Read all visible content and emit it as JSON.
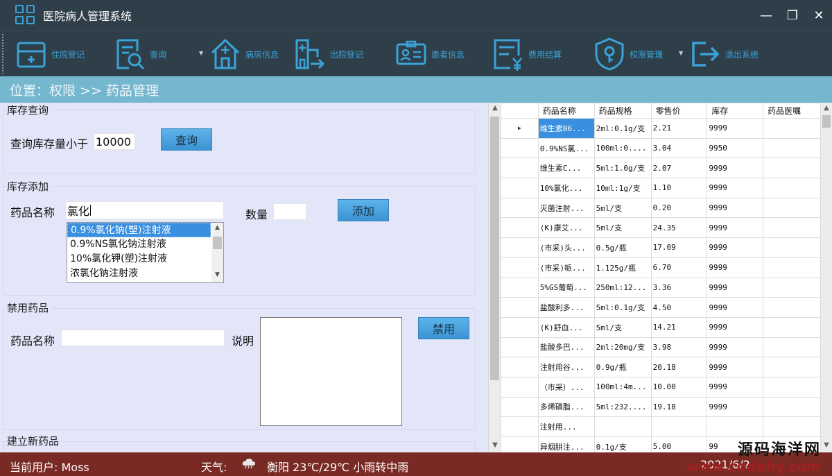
{
  "window": {
    "title": "医院病人管理系统",
    "controls": [
      "—",
      "❐",
      "✕"
    ]
  },
  "toolbar": {
    "items": [
      {
        "label": "住院登记",
        "icon": "admission-icon"
      },
      {
        "label": "查询",
        "icon": "search-document-icon"
      },
      {
        "label": "病房信息",
        "icon": "ward-icon"
      },
      {
        "label": "出院登记",
        "icon": "discharge-icon"
      },
      {
        "label": "患者信息",
        "icon": "patient-card-icon"
      },
      {
        "label": "费用结算",
        "icon": "billing-icon"
      },
      {
        "label": "权限管理",
        "icon": "permission-shield-icon"
      },
      {
        "label": "退出系统",
        "icon": "exit-icon"
      }
    ]
  },
  "breadcrumb": {
    "text": "位置：权限 >> 药品管理"
  },
  "stock_query": {
    "title": "库存查询",
    "label": "查询库存量小于",
    "value": "10000",
    "button": "查询"
  },
  "stock_add": {
    "title": "库存添加",
    "name_label": "药品名称",
    "name_value": "氯化",
    "qty_label": "数量",
    "qty_value": "",
    "button": "添加",
    "suggestions": [
      "0.9%氯化钠(塑)注射液",
      "0.9%NS氯化钠注射液",
      "10%氯化钾(塑)注射液",
      "浓氯化钠注射液"
    ],
    "selected_index": 0
  },
  "ban_drug": {
    "title": "禁用药品",
    "name_label": "药品名称",
    "name_value": "",
    "note_label": "说明",
    "button": "禁用"
  },
  "new_drug": {
    "title": "建立新药品"
  },
  "grid": {
    "columns": [
      "药品名称",
      "药品规格",
      "零售价",
      "库存",
      "药品医嘱"
    ],
    "rows": [
      [
        "维生素B6...",
        "2ml:0.1g/支",
        "2.21",
        "9999",
        ""
      ],
      [
        "0.9%NS氯...",
        "100ml:0....",
        "3.04",
        "9950",
        ""
      ],
      [
        "维生素C...",
        "5ml:1.0g/支",
        "2.07",
        "9999",
        ""
      ],
      [
        "10%氯化...",
        "10ml:1g/支",
        "1.10",
        "9999",
        ""
      ],
      [
        "灭菌注射...",
        "5ml/支",
        "0.20",
        "9999",
        ""
      ],
      [
        "(K)康艾...",
        "5ml/支",
        "24.35",
        "9999",
        ""
      ],
      [
        "(市采)头...",
        "0.5g/瓶",
        "17.09",
        "9999",
        ""
      ],
      [
        "(市采)哌...",
        "1.125g/瓶",
        "6.70",
        "9999",
        ""
      ],
      [
        "5%GS葡萄...",
        "250ml:12...",
        "3.36",
        "9999",
        ""
      ],
      [
        "盐酸利多...",
        "5ml:0.1g/支",
        "4.50",
        "9999",
        ""
      ],
      [
        "(K)舒血...",
        "5ml/支",
        "14.21",
        "9999",
        ""
      ],
      [
        "盐酸多巴...",
        "2ml:20mg/支",
        "3.98",
        "9999",
        ""
      ],
      [
        "注射用谷...",
        "0.9g/瓶",
        "20.18",
        "9999",
        ""
      ],
      [
        "（市采）...",
        "100ml:4m...",
        "10.00",
        "9999",
        ""
      ],
      [
        "多烯磷脂...",
        "5ml:232....",
        "19.18",
        "9999",
        ""
      ],
      [
        "注射用...",
        "",
        "",
        "",
        ""
      ],
      [
        "异烟肼注...",
        "0.1g/支",
        "5.00",
        "99",
        ""
      ]
    ],
    "current_row_marker": "▶"
  },
  "status": {
    "user": "当前用户: Moss",
    "weather_label": "天气:",
    "weather": "衡阳 23℃/29℃ 小雨转中雨",
    "datetime": "2021/6/2"
  },
  "watermark": {
    "line1": "源码海洋网",
    "line2": "www.codehy.com"
  },
  "colors": {
    "titlebar": "#2f3f4a",
    "accent": "#3aa3d8",
    "breadcrumb": "#75b7cf",
    "panel": "#e3e5f8",
    "statusbar": "#7a2a24",
    "selection": "#3a8fe0"
  }
}
